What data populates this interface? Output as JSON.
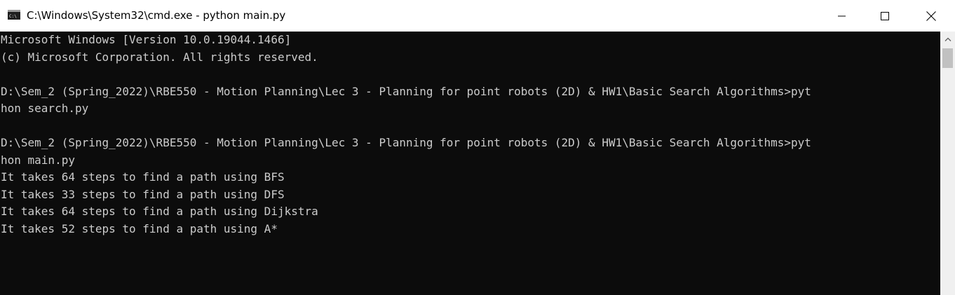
{
  "window": {
    "title": "C:\\Windows\\System32\\cmd.exe - python  main.py",
    "icon": "cmd-icon",
    "controls": {
      "minimize": "minimize-icon",
      "maximize": "maximize-icon",
      "close": "close-icon"
    }
  },
  "console": {
    "background": "#0c0c0c",
    "foreground": "#cccccc",
    "lines": [
      "Microsoft Windows [Version 10.0.19044.1466]",
      "(c) Microsoft Corporation. All rights reserved.",
      "",
      "D:\\Sem_2 (Spring_2022)\\RBE550 - Motion Planning\\Lec 3 - Planning for point robots (2D) & HW1\\Basic Search Algorithms>pyt",
      "hon search.py",
      "",
      "D:\\Sem_2 (Spring_2022)\\RBE550 - Motion Planning\\Lec 3 - Planning for point robots (2D) & HW1\\Basic Search Algorithms>pyt",
      "hon main.py",
      "It takes 64 steps to find a path using BFS",
      "It takes 33 steps to find a path using DFS",
      "It takes 64 steps to find a path using Dijkstra",
      "It takes 52 steps to find a path using A*"
    ]
  },
  "scrollbar": {
    "up_arrow": "chevron-up-icon"
  }
}
